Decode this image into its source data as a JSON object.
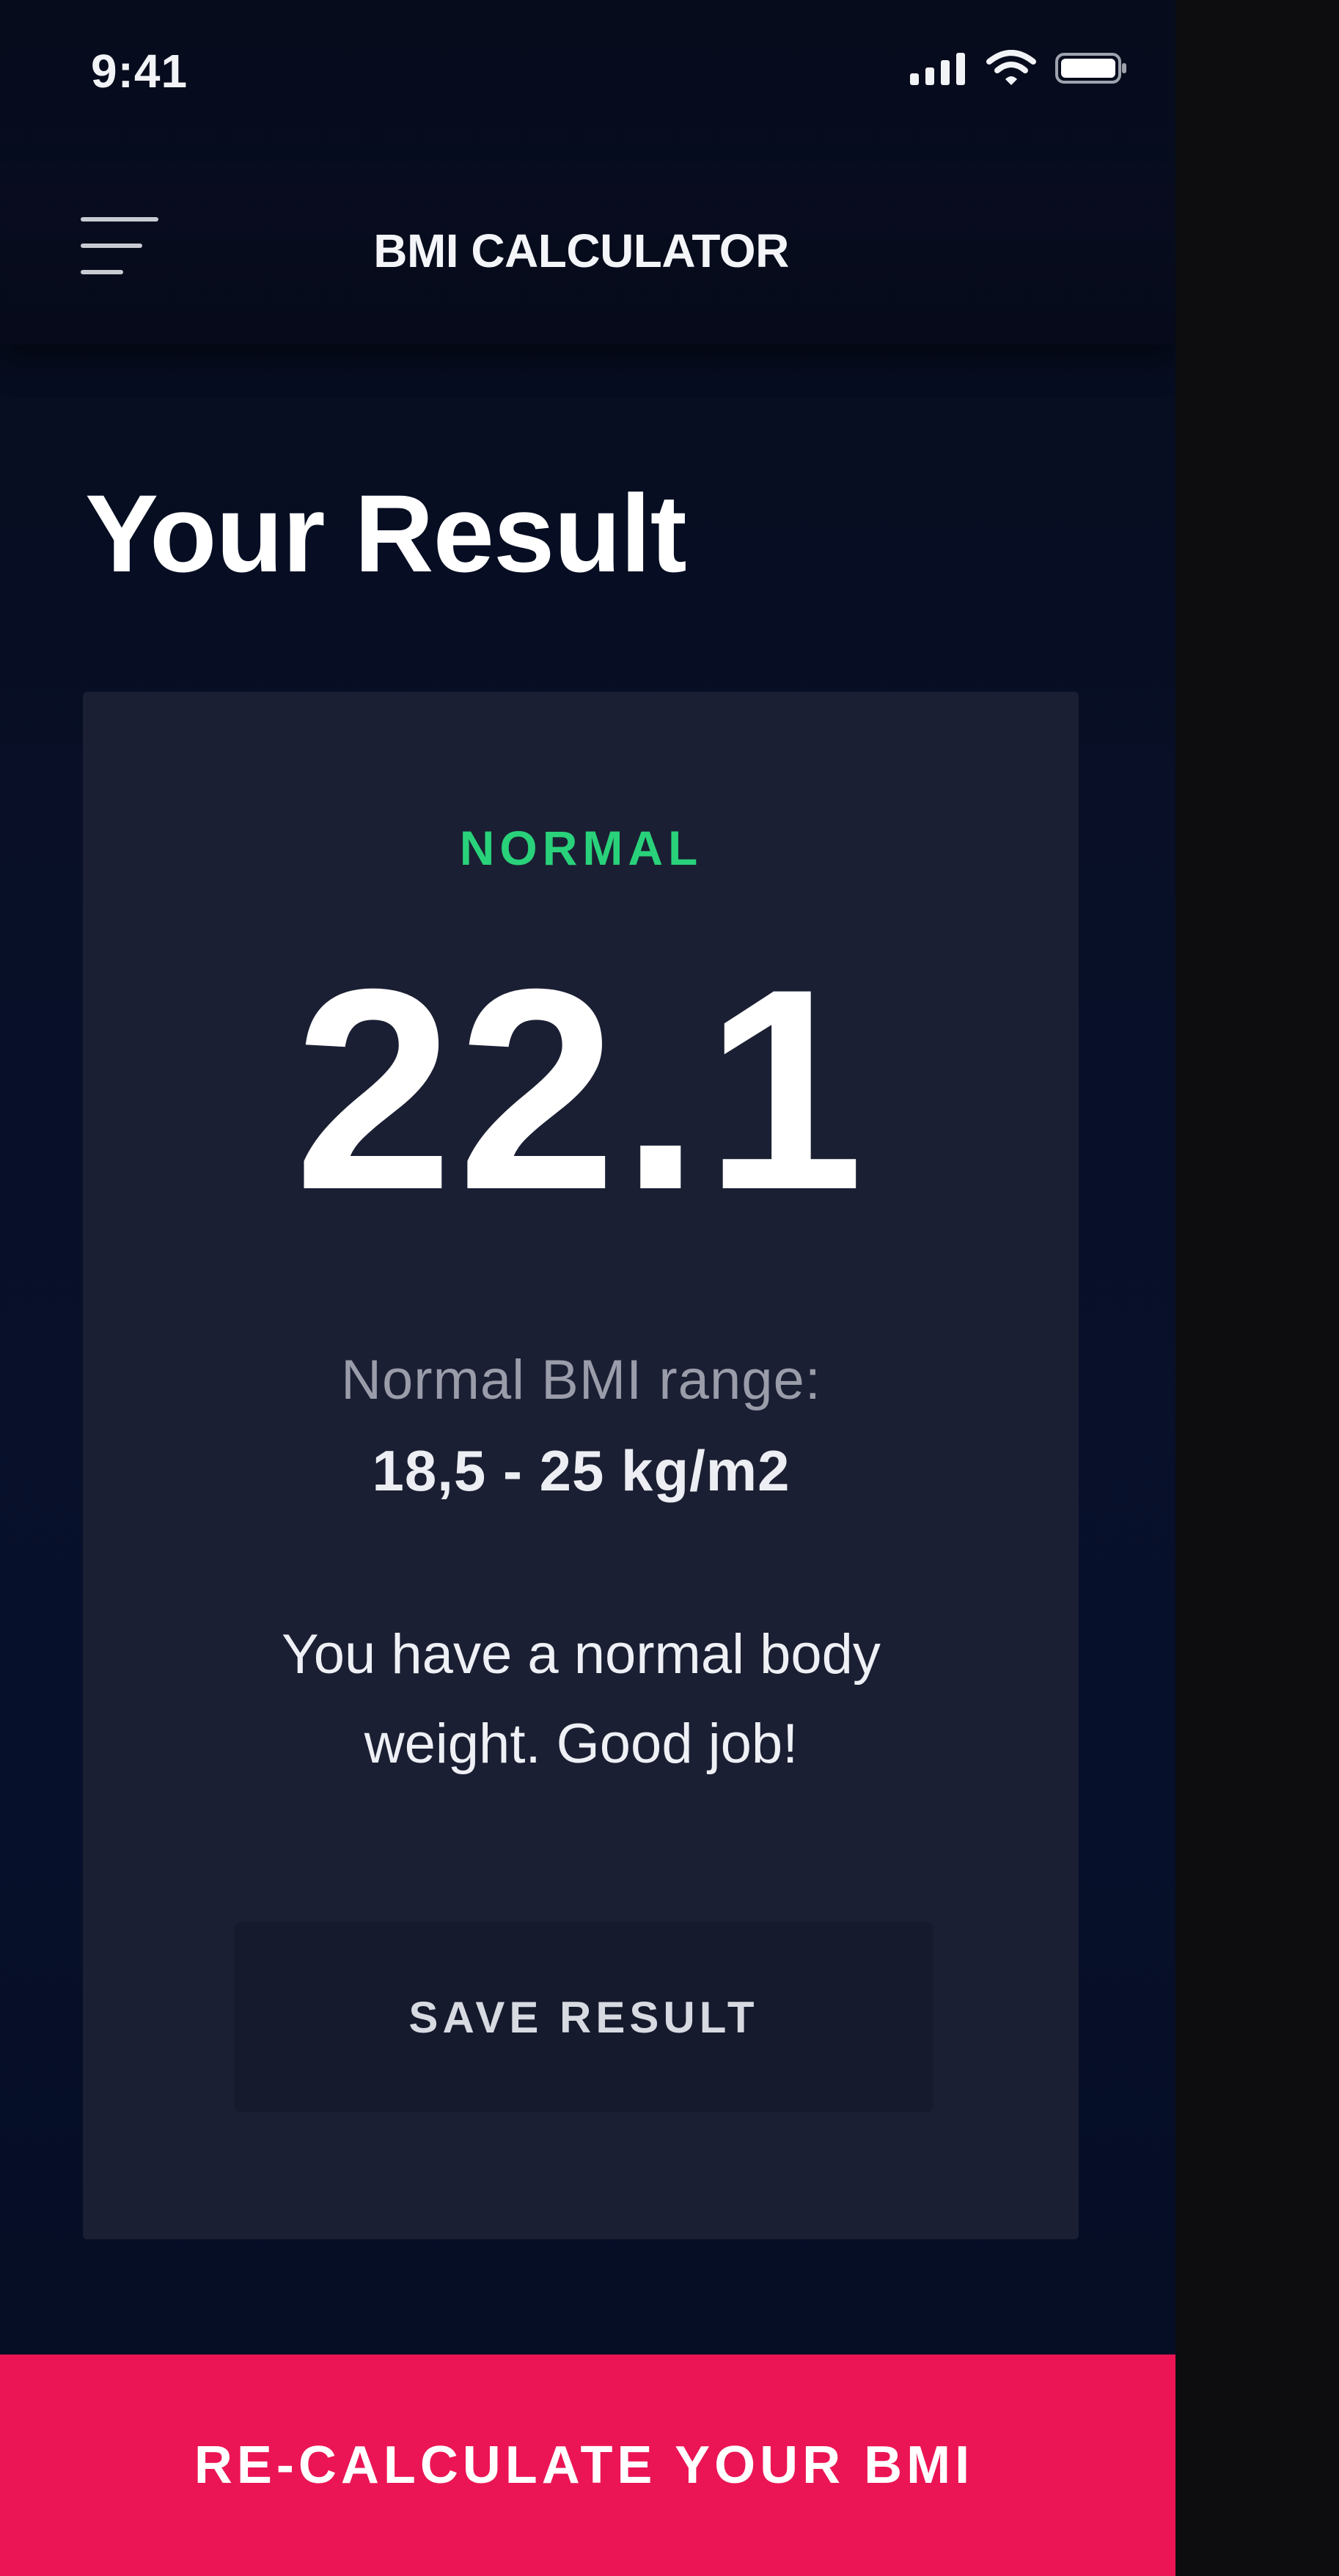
{
  "status_bar": {
    "time": "9:41",
    "icons": [
      "cellular-signal-icon",
      "wifi-icon",
      "battery-icon"
    ]
  },
  "header": {
    "menu_icon": "hamburger-menu-icon",
    "title": "BMI CALCULATOR"
  },
  "page": {
    "title": "Your Result"
  },
  "result": {
    "category": "NORMAL",
    "bmi": "22.1",
    "range_label": "Normal BMI range:",
    "range_value": "18,5 - 25 kg/m2",
    "interpretation": "You have a normal body weight. Good job!",
    "save_label": "SAVE RESULT"
  },
  "footer": {
    "recalculate_label": "RE-CALCULATE YOUR BMI"
  },
  "colors": {
    "background": "#070f26",
    "card": "#1b1f33",
    "accent_normal": "#29d27a",
    "primary_button": "#eb1555",
    "secondary_button": "#161a2d"
  }
}
